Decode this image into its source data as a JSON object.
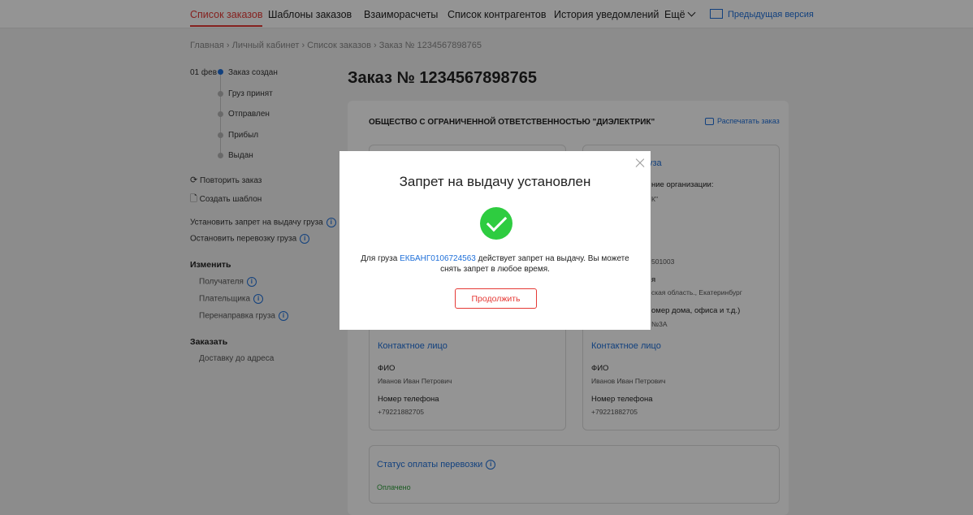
{
  "nav": {
    "items": [
      "Список заказов",
      "Шаблоны заказов",
      "Взаиморасчеты",
      "Список контрагентов",
      "История уведомлений"
    ],
    "more": "Ещё",
    "prev_version": "Предыдущая версия"
  },
  "breadcrumb": "Главная › Личный кабинет › Список заказов › Заказ № 1234567898765",
  "timeline": {
    "date": "01 фев",
    "steps": [
      "Заказ создан",
      "Груз принят",
      "Отправлен",
      "Прибыл",
      "Выдан"
    ]
  },
  "sidebar": {
    "repeat": "Повторить заказ",
    "template": "Создать шаблон",
    "set_ban": "Установить запрет на выдачу груза",
    "stop": "Остановить перевозку груза",
    "change_head": "Изменить",
    "change_items": [
      "Получателя",
      "Плательщика",
      "Перенаправка груза"
    ],
    "order_head": "Заказать",
    "order_items": [
      "Доставку до адреса"
    ]
  },
  "order": {
    "title": "Заказ № 1234567898765",
    "company": "ОБЩЕСТВО С ОГРАНИЧЕННОЙ ОТВЕТСТВЕННОСТЬЮ \"ДИЭЛЕКТРИК\"",
    "print": "Распечатать заказ"
  },
  "right_card": {
    "title_tail": "уза",
    "org_label_tail": "ние организации:",
    "org_value_tail": "К\"",
    "kpp_tail": "501003",
    "city_label_tail": "я",
    "city_value_tail": "ская область., Екатеринбург",
    "address_label_tail": "омер дома, офиса и т.д.)",
    "address_value_tail": "№3А"
  },
  "contacts": {
    "title": "Контактное лицо",
    "fio_label": "ФИО",
    "fio_value": "Иванов Иван Петрович",
    "phone_label": "Номер телефона",
    "phone_value": "+79221882705"
  },
  "payment": {
    "title": "Статус оплаты перевозки",
    "status": "Оплачено"
  },
  "modal": {
    "title": "Запрет на выдачу установлен",
    "text_before": "Для груза ",
    "cargo_id": "ЕКБАНГ0106724563",
    "text_after": " действует запрет на выдачу. Вы можете снять запрет в любое время.",
    "button": "Продолжить"
  },
  "colors": {
    "accent_red": "#e53935",
    "link_blue": "#1e6fd9",
    "success_green": "#2ecc40",
    "paid_green": "#2e9d3a"
  },
  "icons": [
    "chevron-down-icon",
    "monitor-icon",
    "repeat-icon",
    "document-icon",
    "info-icon",
    "printer-icon",
    "close-icon",
    "checkmark-icon"
  ]
}
